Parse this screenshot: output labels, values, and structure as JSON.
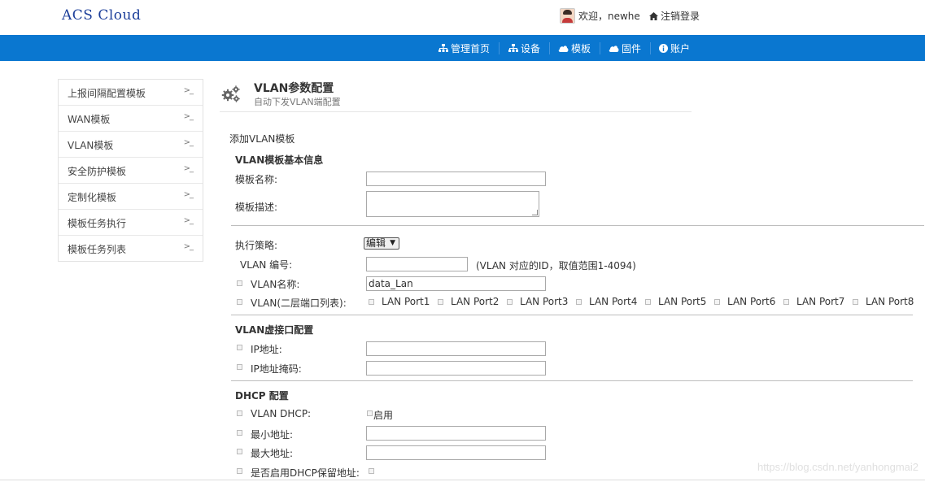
{
  "app": {
    "logo": "ACS Cloud"
  },
  "header": {
    "welcome": "欢迎，newhe",
    "logout": "注销登录"
  },
  "nav": [
    {
      "label": "管理首页",
      "icon": "sitemap-icon"
    },
    {
      "label": "设备",
      "icon": "sitemap-icon"
    },
    {
      "label": "模板",
      "icon": "cloud-icon"
    },
    {
      "label": "固件",
      "icon": "cloud-icon"
    },
    {
      "label": "账户",
      "icon": "info-icon"
    }
  ],
  "sidebar": {
    "arrow": ">_",
    "items": [
      {
        "label": "上报间隔配置模板"
      },
      {
        "label": "WAN模板"
      },
      {
        "label": "VLAN模板"
      },
      {
        "label": "安全防护模板"
      },
      {
        "label": "定制化模板"
      },
      {
        "label": "模板任务执行"
      },
      {
        "label": "模板任务列表"
      }
    ]
  },
  "page": {
    "title": "VLAN参数配置",
    "subtitle": "自动下发VLAN端配置"
  },
  "form": {
    "add_title": "添加VLAN模板",
    "basic_section": "VLAN模板基本信息",
    "template_name_label": "模板名称:",
    "template_name_value": "",
    "template_desc_label": "模板描述:",
    "strategy_label": "执行策略:",
    "strategy_value": "编辑",
    "vlan_id_label": "VLAN 编号:",
    "vlan_id_value": "",
    "vlan_id_hint": "(VLAN 对应的ID，取值范围1-4094)",
    "vlan_name_label": "VLAN名称:",
    "vlan_name_value": "data_Lan",
    "vlan_ports_label": "VLAN(二层端口列表):",
    "ports": [
      "LAN Port1",
      "LAN Port2",
      "LAN Port3",
      "LAN Port4",
      "LAN Port5",
      "LAN Port6",
      "LAN Port7",
      "LAN Port8"
    ],
    "vif_section": "VLAN虚接口配置",
    "ip_label": "IP地址:",
    "ip_value": "",
    "mask_label": "IP地址掩码:",
    "mask_value": "",
    "dhcp_section": "DHCP 配置",
    "vlan_dhcp_label": "VLAN DHCP:",
    "enable_label": "启用",
    "min_addr_label": "最小地址:",
    "min_addr_value": "",
    "max_addr_label": "最大地址:",
    "max_addr_value": "",
    "reserve_label": "是否启用DHCP保留地址:"
  },
  "watermark": "https://blog.csdn.net/yanhongmai2"
}
